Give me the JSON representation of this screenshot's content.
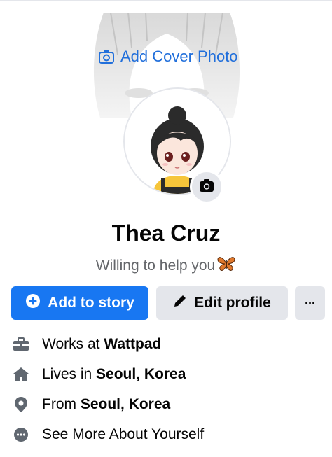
{
  "cover": {
    "add_cover_label": "Add Cover Photo"
  },
  "profile": {
    "name": "Thea Cruz",
    "bio": "Willing to help you",
    "bio_emoji": "butterfly-emoji"
  },
  "actions": {
    "add_story_label": "Add to story",
    "edit_profile_label": "Edit profile",
    "more_label": "···"
  },
  "details": [
    {
      "icon": "briefcase-icon",
      "prefix": "Works at",
      "value": "Wattpad"
    },
    {
      "icon": "home-icon",
      "prefix": "Lives in",
      "value": "Seoul, Korea"
    },
    {
      "icon": "location-pin-icon",
      "prefix": "From",
      "value": "Seoul, Korea"
    },
    {
      "icon": "more-circle-icon",
      "prefix": "See More About Yourself",
      "value": ""
    }
  ],
  "colors": {
    "primary": "#1877f2",
    "link": "#216fdb",
    "button_gray": "#e4e6eb",
    "muted_text": "#65676b"
  }
}
